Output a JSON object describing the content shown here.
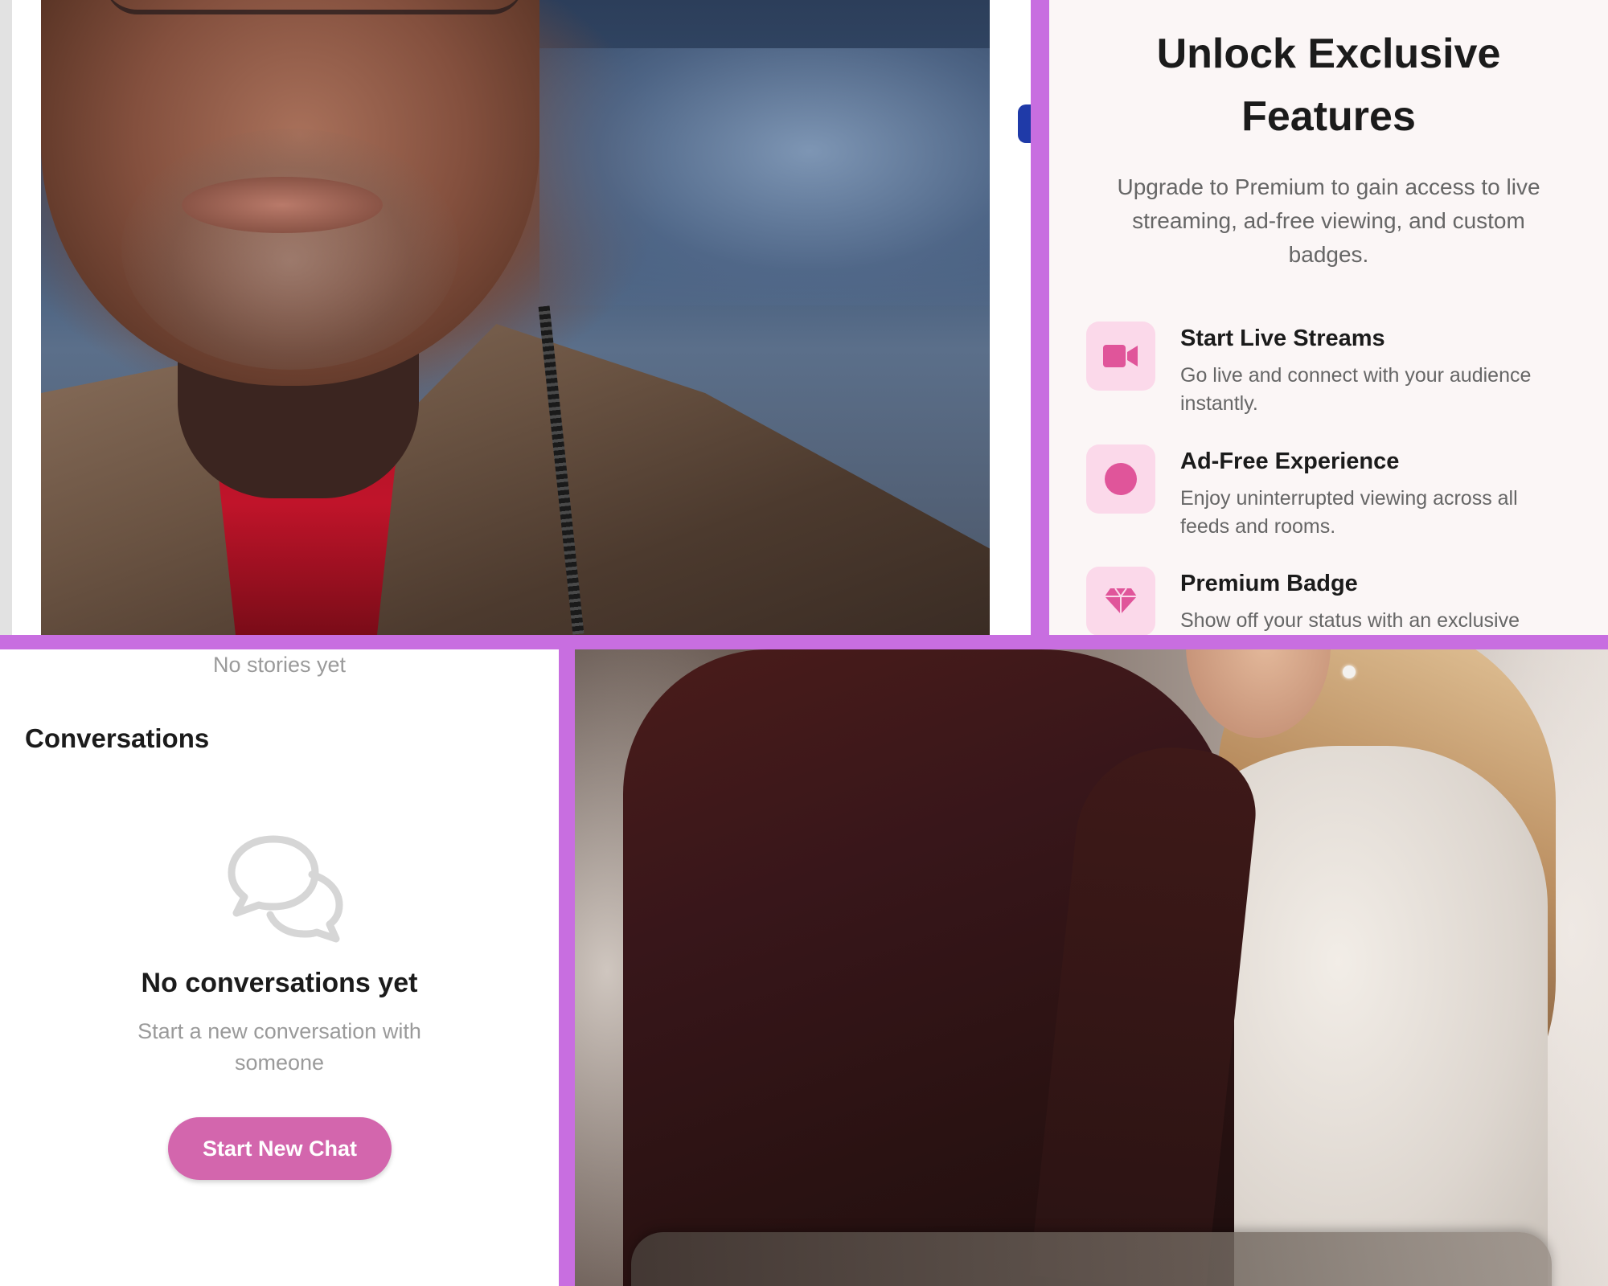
{
  "premium": {
    "title_line1": "Unlock Exclusive",
    "title_line2": "Features",
    "subtitle_line1": "Upgrade to Premium to gain access to live",
    "subtitle_line2": "streaming, ad-free viewing, and custom",
    "subtitle_line3": "badges.",
    "accent_color": "#e0559a",
    "icon_bg_color": "#fbd9ea",
    "features": [
      {
        "icon": "video-camera-icon",
        "title": "Start Live Streams",
        "desc_line1": "Go live and connect with your audience",
        "desc_line2": "instantly."
      },
      {
        "icon": "circle-icon",
        "title": "Ad-Free Experience",
        "desc_line1": "Enjoy uninterrupted viewing across all",
        "desc_line2": "feeds and rooms."
      },
      {
        "icon": "diamond-icon",
        "title": "Premium Badge",
        "desc_line1": "Show off your status with an exclusive",
        "desc_line2": ""
      }
    ]
  },
  "chats": {
    "stories_empty": "No stories yet",
    "section_title": "Conversations",
    "empty_icon": "chat-bubbles-icon",
    "empty_title": "No conversations yet",
    "empty_sub_line1": "Start a new conversation with",
    "empty_sub_line2": "someone",
    "start_button": "Start New Chat",
    "button_color": "#d366ad"
  },
  "divider_color": "#c86ee0"
}
